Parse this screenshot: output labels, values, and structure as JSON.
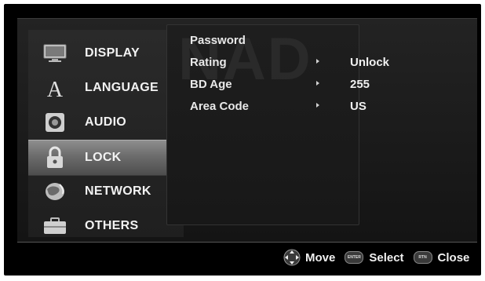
{
  "watermark": "NAD",
  "sidebar": {
    "items": [
      {
        "label": "DISPLAY",
        "icon": "monitor-icon"
      },
      {
        "label": "LANGUAGE",
        "icon": "letter-a-icon"
      },
      {
        "label": "AUDIO",
        "icon": "speaker-icon"
      },
      {
        "label": "LOCK",
        "icon": "padlock-icon",
        "selected": true
      },
      {
        "label": "NETWORK",
        "icon": "globe-icon"
      },
      {
        "label": "OTHERS",
        "icon": "toolbox-icon"
      }
    ]
  },
  "submenu": {
    "rows": [
      {
        "label": "Password",
        "value": ""
      },
      {
        "label": "Rating",
        "value": "Unlock"
      },
      {
        "label": "BD Age",
        "value": "255"
      },
      {
        "label": "Area Code",
        "value": "US"
      }
    ]
  },
  "footer": {
    "move": "Move",
    "enter_badge": "ENTER",
    "select": "Select",
    "return_badge": "RTN",
    "close": "Close"
  },
  "colors": {
    "background": "#000000",
    "panel": "#1f1f1f",
    "selected_highlight": "#7a7a7a",
    "text": "#f0f0f0"
  }
}
